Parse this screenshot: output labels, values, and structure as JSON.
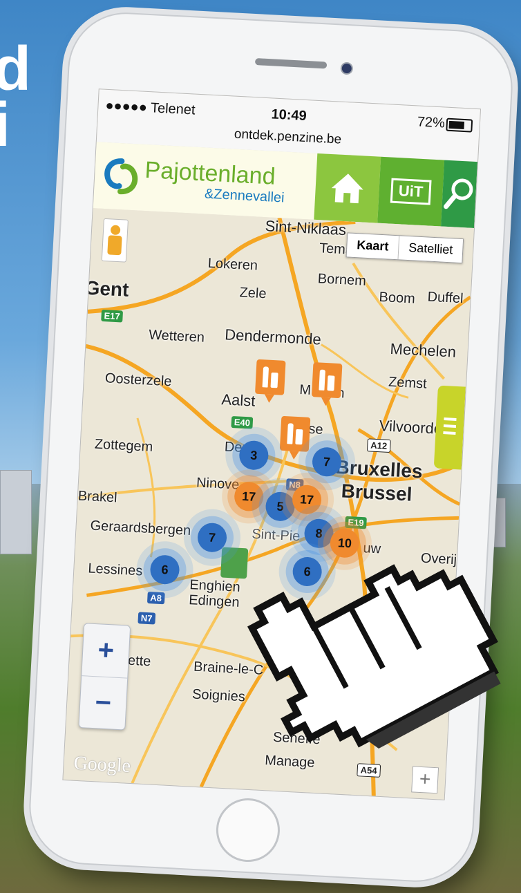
{
  "status": {
    "carrier": "●●●●● Telenet",
    "time": "10:49",
    "battery": "72%",
    "url": "ontdek.penzine.be"
  },
  "header": {
    "logo_name": "Pajottenland",
    "logo_sub": "&Zennevallei",
    "nav": [
      {
        "name": "home-icon",
        "color": "#8cc63f"
      },
      {
        "name": "uit-icon",
        "label": "UiT",
        "color": "#5fb030"
      },
      {
        "name": "search-icon",
        "color": "#2f9a46"
      }
    ]
  },
  "map": {
    "type_buttons": [
      "Kaart",
      "Satelliet"
    ],
    "places": [
      {
        "name": "Sint-Niklaas"
      },
      {
        "name": "Temse"
      },
      {
        "name": "Lokeren"
      },
      {
        "name": "Bornem"
      },
      {
        "name": "Gent"
      },
      {
        "name": "Zele"
      },
      {
        "name": "Boom"
      },
      {
        "name": "Duffel"
      },
      {
        "name": "Dendermonde"
      },
      {
        "name": "Mechelen"
      },
      {
        "name": "Wetteren"
      },
      {
        "name": "Zemst"
      },
      {
        "name": "Oosterzele"
      },
      {
        "name": "Aalst"
      },
      {
        "name": "Vilvoorde"
      },
      {
        "name": "Zottegem"
      },
      {
        "name": "Bruxelles"
      },
      {
        "name": "Brussel"
      },
      {
        "name": "Ninove"
      },
      {
        "name": "Brakel"
      },
      {
        "name": "Geraardsbergen"
      },
      {
        "name": "Sint-Pie"
      },
      {
        "name": "Overijs"
      },
      {
        "name": "Lessines"
      },
      {
        "name": "Enghien"
      },
      {
        "name": "Edingen"
      },
      {
        "name": "Braine-le-C"
      },
      {
        "name": "Soignies"
      },
      {
        "name": "Seneffe"
      },
      {
        "name": "Manage"
      },
      {
        "name": "Dende"
      },
      {
        "name": "M"
      },
      {
        "name": "tem"
      },
      {
        "name": "se"
      },
      {
        "name": "uw"
      },
      {
        "name": "rugelette"
      }
    ],
    "road_shields": [
      "E17",
      "E40",
      "A12",
      "N8",
      "E19",
      "A8",
      "N7",
      "A54"
    ],
    "clusters": [
      {
        "count": "3",
        "color": "blue"
      },
      {
        "count": "7",
        "color": "blue"
      },
      {
        "count": "17",
        "color": "orange"
      },
      {
        "count": "5",
        "color": "blue"
      },
      {
        "count": "17",
        "color": "orange"
      },
      {
        "count": "8",
        "color": "blue"
      },
      {
        "count": "10",
        "color": "orange"
      },
      {
        "count": "7",
        "color": "blue"
      },
      {
        "count": "6",
        "color": "blue"
      },
      {
        "count": "6",
        "color": "blue"
      }
    ],
    "zoom_in": "+",
    "zoom_out": "−",
    "attribution": "Google"
  }
}
